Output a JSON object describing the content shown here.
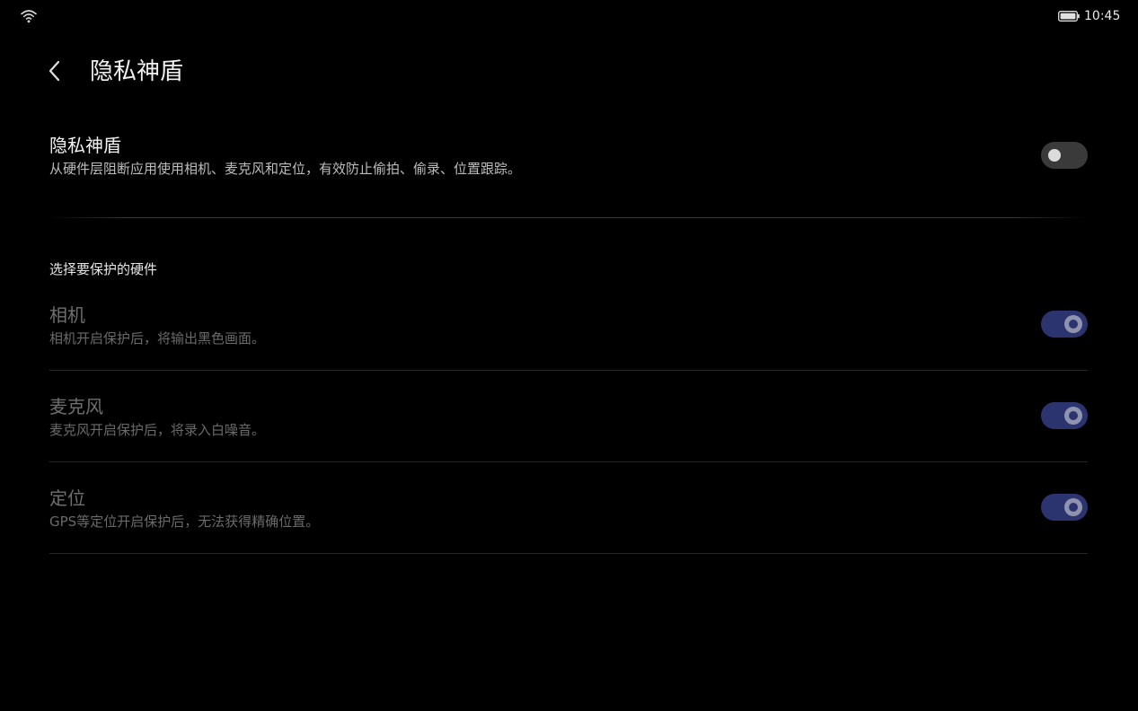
{
  "status_bar": {
    "time": "10:45",
    "wifi_icon": "wifi-icon",
    "battery_icon": "battery-icon"
  },
  "header": {
    "back_icon": "chevron-left-icon",
    "title": "隐私神盾"
  },
  "master_toggle": {
    "title": "隐私神盾",
    "subtitle": "从硬件层阻断应用使用相机、麦克风和定位，有效防止偷拍、偷录、位置跟踪。",
    "state": "off"
  },
  "section": {
    "label": "选择要保护的硬件",
    "items": [
      {
        "title": "相机",
        "subtitle": "相机开启保护后，将输出黑色画面。",
        "state": "on",
        "enabled": false
      },
      {
        "title": "麦克风",
        "subtitle": "麦克风开启保护后，将录入白噪音。",
        "state": "on",
        "enabled": false
      },
      {
        "title": "定位",
        "subtitle": "GPS等定位开启保护后，无法获得精确位置。",
        "state": "on",
        "enabled": false
      }
    ]
  },
  "colors": {
    "background": "#000000",
    "switch_on_track": "#2c3470",
    "switch_off_track": "#3a3a3a"
  }
}
